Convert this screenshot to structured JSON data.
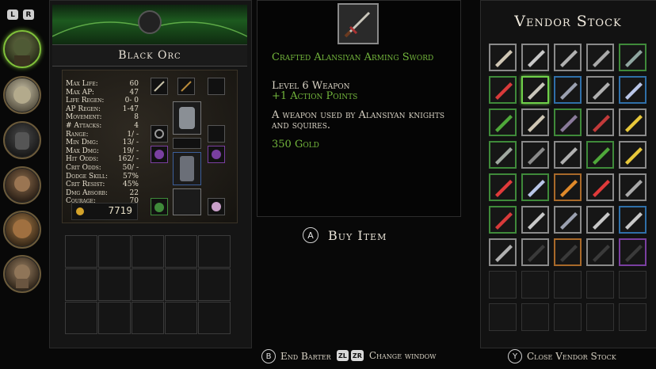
{
  "shoulder_buttons": {
    "left": "L",
    "right": "R"
  },
  "character": {
    "name": "Black Orc",
    "stats": [
      {
        "label": "Max Life:",
        "value": "60"
      },
      {
        "label": "Max AP:",
        "value": "47"
      },
      {
        "label": "Life Regen:",
        "value": "0- 0"
      },
      {
        "label": "AP Regen:",
        "value": "1-47"
      },
      {
        "label": "Movement:",
        "value": "8"
      },
      {
        "label": "# Attacks:",
        "value": "4"
      },
      {
        "label": "Range:",
        "value": "1/ -"
      },
      {
        "label": "Min Dmg:",
        "value": "13/ -"
      },
      {
        "label": "Max Dmg:",
        "value": "19/ -"
      },
      {
        "label": "Hit Odds:",
        "value": "162/ -"
      },
      {
        "label": "Crit Odds:",
        "value": "50/ -"
      },
      {
        "label": "Dodge Skill:",
        "value": "57%"
      },
      {
        "label": "Crit Resist:",
        "value": "45%"
      },
      {
        "label": "Dmg Absorb:",
        "value": "22"
      },
      {
        "label": "Courage:",
        "value": "70"
      }
    ],
    "gold": "7719"
  },
  "item": {
    "name": "Crafted Alansiyan Arming Sword",
    "level": "Level 6 Weapon",
    "bonus": "+1 Action Points",
    "description": "A weapon used by Alansiyan knights and squires.",
    "price": "350 Gold"
  },
  "buy": {
    "button": "A",
    "label": "Buy Item"
  },
  "footer": {
    "end_barter_button": "B",
    "end_barter": "End Barter",
    "change_buttons": [
      "ZL",
      "ZR"
    ],
    "change_window": "Change window",
    "close_button": "Y",
    "close_vendor": "Close Vendor Stock"
  },
  "vendor": {
    "title": "Vendor Stock",
    "rarity_colors": {
      "common": "#8a8a8a",
      "uncommon": "#3f8a3a",
      "rare": "#2f6fa8",
      "epic": "#7a3fa0",
      "selected": "#6fd04a",
      "orange": "#a8692a"
    },
    "items": [
      [
        "tome-icon",
        "common"
      ],
      [
        "sword-icon",
        "common"
      ],
      [
        "axe-icon",
        "common"
      ],
      [
        "hammer-icon",
        "common"
      ],
      [
        "mace-icon",
        "uncommon"
      ],
      [
        "dagger-icon",
        "uncommon"
      ],
      [
        "arming-sword-icon",
        "selected"
      ],
      [
        "flail-icon",
        "rare"
      ],
      [
        "axe-icon",
        "common"
      ],
      [
        "leaf-blade-icon",
        "rare"
      ],
      [
        "herb-icon",
        "uncommon"
      ],
      [
        "tome-icon",
        "common"
      ],
      [
        "spiked-mace-icon",
        "uncommon"
      ],
      [
        "scythe-icon",
        "common"
      ],
      [
        "golden-blade-icon",
        "common"
      ],
      [
        "chest-armor-icon",
        "uncommon"
      ],
      [
        "morning-star-icon",
        "common"
      ],
      [
        "axe-icon",
        "common"
      ],
      [
        "herb-icon",
        "uncommon"
      ],
      [
        "golden-blade-icon",
        "common"
      ],
      [
        "red-blade-icon",
        "uncommon"
      ],
      [
        "leaf-blade-icon",
        "uncommon"
      ],
      [
        "orange-blade-icon",
        "orange"
      ],
      [
        "red-blade-icon",
        "common"
      ],
      [
        "hammer-icon",
        "common"
      ],
      [
        "dagger-icon",
        "uncommon"
      ],
      [
        "sword-icon",
        "common"
      ],
      [
        "flail-icon",
        "common"
      ],
      [
        "sword-icon",
        "common"
      ],
      [
        "sword-icon",
        "rare"
      ],
      [
        "axe-icon",
        "common"
      ],
      [
        "faded-item-icon",
        "common"
      ],
      [
        "faded-item-icon",
        "orange"
      ],
      [
        "faded-item-icon",
        "common"
      ],
      [
        "faded-item-icon",
        "epic"
      ]
    ]
  }
}
